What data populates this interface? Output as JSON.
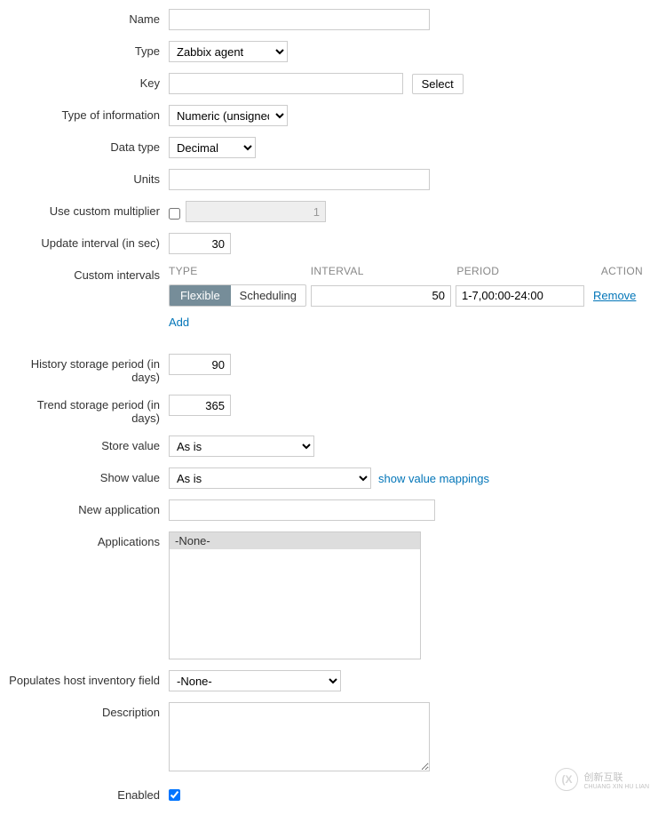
{
  "labels": {
    "name": "Name",
    "type": "Type",
    "key": "Key",
    "type_of_information": "Type of information",
    "data_type": "Data type",
    "units": "Units",
    "use_custom_multiplier": "Use custom multiplier",
    "update_interval": "Update interval (in sec)",
    "custom_intervals": "Custom intervals",
    "history_storage": "History storage period (in days)",
    "trend_storage": "Trend storage period (in days)",
    "store_value": "Store value",
    "show_value": "Show value",
    "new_application": "New application",
    "applications": "Applications",
    "populates_inventory": "Populates host inventory field",
    "description": "Description",
    "enabled": "Enabled"
  },
  "values": {
    "name": "",
    "type": "Zabbix agent",
    "key": "",
    "select_btn": "Select",
    "type_of_information": "Numeric (unsigned)",
    "data_type": "Decimal",
    "units": "",
    "multiplier_value": "1",
    "update_interval": "30",
    "history_storage": "90",
    "trend_storage": "365",
    "store_value": "As is",
    "show_value": "As is",
    "show_value_link": "show value mappings",
    "new_application": "",
    "applications_none": "-None-",
    "inventory_none": "-None-",
    "description": ""
  },
  "custom_intervals": {
    "headers": {
      "type": "TYPE",
      "interval": "INTERVAL",
      "period": "PERIOD",
      "action": "ACTION"
    },
    "flexible": "Flexible",
    "scheduling": "Scheduling",
    "interval_value": "50",
    "period_value": "1-7,00:00-24:00",
    "remove": "Remove",
    "add": "Add"
  },
  "logo": {
    "mark": "(X",
    "text1": "创新互联",
    "text2": "CHUANG XIN HU LIAN"
  }
}
